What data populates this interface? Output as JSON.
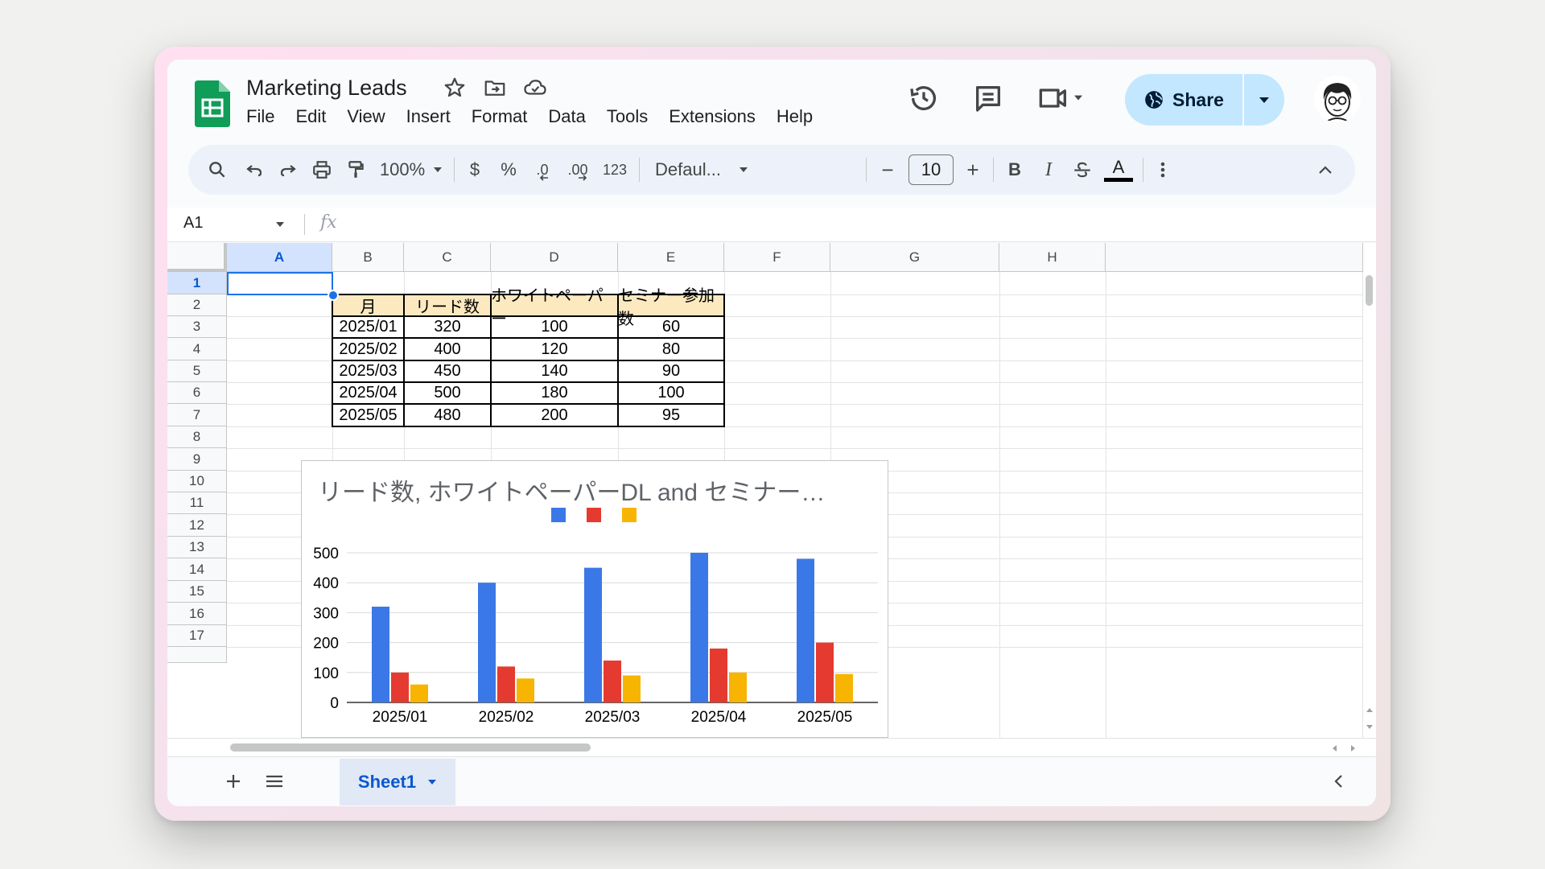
{
  "app": {
    "doc_title": "Marketing Leads",
    "menu": [
      "File",
      "Edit",
      "View",
      "Insert",
      "Format",
      "Data",
      "Tools",
      "Extensions",
      "Help"
    ],
    "share_label": "Share"
  },
  "toolbar": {
    "zoom": "100%",
    "currency": "$",
    "percent": "%",
    "dec_decrease": ".0",
    "dec_increase": ".00",
    "number_format": "123",
    "font": "Defaul...",
    "font_size": "10",
    "minus": "−",
    "plus": "+",
    "bold": "B",
    "italic": "I",
    "text_color": "A"
  },
  "formula_bar": {
    "name_box": "A1",
    "fx": "fx"
  },
  "grid": {
    "columns": [
      "A",
      "B",
      "C",
      "D",
      "E",
      "F",
      "G",
      "H"
    ],
    "selected_column": "A",
    "rows": [
      "1",
      "2",
      "3",
      "4",
      "5",
      "6",
      "7",
      "8",
      "9",
      "10",
      "11",
      "12",
      "13",
      "14",
      "15",
      "16",
      "17"
    ],
    "selected_row": "1"
  },
  "table": {
    "headers": [
      "月",
      "リード数",
      "ホワイトペーパー",
      "セミナー参加数"
    ],
    "rows": [
      [
        "2025/01",
        "320",
        "100",
        "60"
      ],
      [
        "2025/02",
        "400",
        "120",
        "80"
      ],
      [
        "2025/03",
        "450",
        "140",
        "90"
      ],
      [
        "2025/04",
        "500",
        "180",
        "100"
      ],
      [
        "2025/05",
        "480",
        "200",
        "95"
      ]
    ],
    "header_bg": "#fde9bf"
  },
  "chart_data": {
    "type": "bar",
    "title": "リード数, ホワイトペーパーDL and セミナー…",
    "categories": [
      "2025/01",
      "2025/02",
      "2025/03",
      "2025/04",
      "2025/05"
    ],
    "series": [
      {
        "color": "#3b78e7",
        "values": [
          320,
          400,
          450,
          500,
          480
        ]
      },
      {
        "color": "#e53a2f",
        "values": [
          100,
          120,
          140,
          180,
          200
        ]
      },
      {
        "color": "#f7b400",
        "values": [
          60,
          80,
          90,
          100,
          95
        ]
      }
    ],
    "ylim": [
      0,
      500
    ],
    "yticks": [
      "0",
      "100",
      "200",
      "300",
      "400",
      "500"
    ],
    "grid": true,
    "legend": "top"
  },
  "sheets": {
    "active": "Sheet1"
  },
  "colors": {
    "accent": "#0b57d0",
    "share_bg": "#c2e7ff",
    "sheets_green": "#0f9d58"
  }
}
